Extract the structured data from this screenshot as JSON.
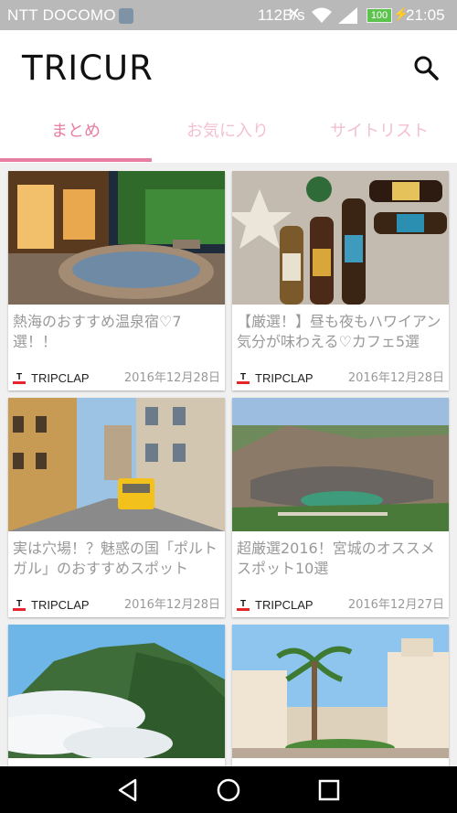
{
  "status_bar": {
    "carrier": "NTT DOCOMO",
    "speed": "112B/s",
    "battery": "100",
    "time": "21:05"
  },
  "app": {
    "logo": "TRICUR",
    "search_icon": "search-icon"
  },
  "tabs": [
    {
      "label": "まとめ",
      "active": true
    },
    {
      "label": "お気に入り",
      "active": false
    },
    {
      "label": "サイトリスト",
      "active": false
    }
  ],
  "colors": {
    "accent": "#e77ea1",
    "tab_inactive": "#f3bfd3",
    "source_logo_red": "#e5242b"
  },
  "cards": [
    {
      "title": "熱海のおすすめ温泉宿♡7選！！",
      "source": "TRIPCLAP",
      "date": "2016年12月28日",
      "image": "outdoor-hot-spring-bath"
    },
    {
      "title": "【厳選！】昼も夜もハワイアン気分が味わえる♡カフェ5選",
      "source": "TRIPCLAP",
      "date": "2016年12月28日",
      "image": "beer-bottles-with-starfish"
    },
    {
      "title": "実は穴場！？魅惑の国「ポルトガル」のおすすめスポット",
      "source": "TRIPCLAP",
      "date": "2016年12月28日",
      "image": "lisbon-tram-street"
    },
    {
      "title": "超厳選2016！宮城のオススメスポット10選",
      "source": "TRIPCLAP",
      "date": "2016年12月27日",
      "image": "crater-lake-okama"
    },
    {
      "title": "",
      "source": "",
      "date": "",
      "image": "mountains-above-clouds"
    },
    {
      "title": "",
      "source": "",
      "date": "",
      "image": "palm-tree-outlet-mall"
    }
  ],
  "nav_bar": {
    "back": "back-icon",
    "home": "home-icon",
    "recents": "recents-icon"
  }
}
